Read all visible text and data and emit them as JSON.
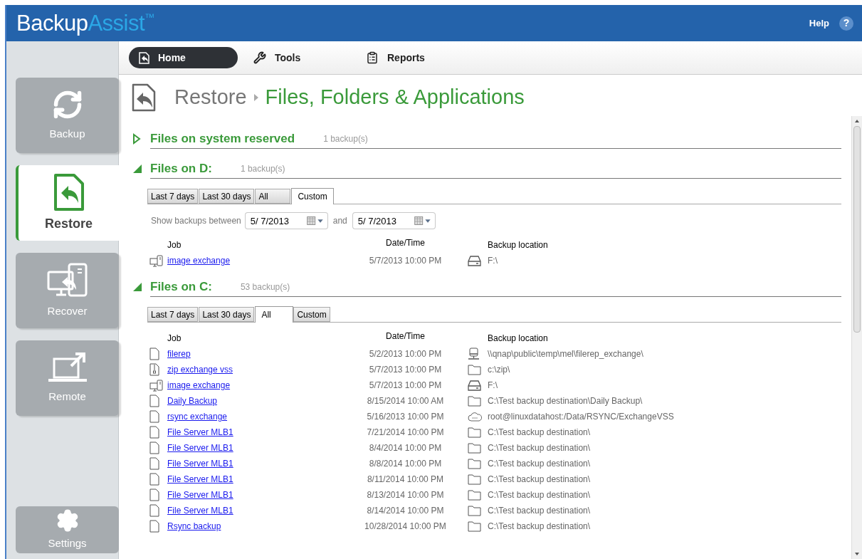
{
  "app": {
    "brand": "Backup",
    "brand_accent": "Assist",
    "trademark": "™",
    "help": "Help",
    "help_icon": "?"
  },
  "sidebar": {
    "items": [
      {
        "label": "Backup",
        "kind": "backup",
        "selected": false
      },
      {
        "label": "Restore",
        "kind": "restore",
        "selected": true
      },
      {
        "label": "Recover",
        "kind": "recover",
        "selected": false
      },
      {
        "label": "Remote",
        "kind": "remote",
        "selected": false
      },
      {
        "label": "Settings",
        "kind": "settings",
        "selected": false
      }
    ]
  },
  "toolbar": {
    "items": [
      {
        "label": "Home",
        "kind": "home",
        "selected": true
      },
      {
        "label": "Tools",
        "kind": "tools",
        "selected": false
      },
      {
        "label": "Reports",
        "kind": "reports",
        "selected": false
      }
    ]
  },
  "breadcrumb": {
    "parent": "Restore",
    "current": "Files, Folders & Applications"
  },
  "sections": [
    {
      "title": "Files on system reserved",
      "count": "1 backup(s)",
      "expanded": false
    },
    {
      "title": "Files on D:",
      "count": "1 backup(s)",
      "expanded": true,
      "tabs": [
        {
          "label": "Last 7 days",
          "selected": false
        },
        {
          "label": "Last 30 days",
          "selected": false
        },
        {
          "label": "All",
          "selected": false
        },
        {
          "label": "Custom",
          "selected": true
        }
      ],
      "filter": {
        "label": "Show backups between",
        "from": "5/ 7/2013",
        "joiner": "and",
        "to": "5/ 7/2013"
      },
      "columns": [
        "Job",
        "Date/Time",
        "Backup location"
      ],
      "rows": [
        {
          "job": {
            "kind": "image",
            "label": "image exchange"
          },
          "date": "5/7/2013 10:00 PM",
          "location": {
            "kind": "drive",
            "path": "F:\\"
          }
        }
      ]
    },
    {
      "title": "Files on C:",
      "count": "53 backup(s)",
      "expanded": true,
      "tabs": [
        {
          "label": "Last 7 days",
          "selected": false
        },
        {
          "label": "Last 30 days",
          "selected": false
        },
        {
          "label": "All",
          "selected": true
        },
        {
          "label": "Custom",
          "selected": false
        }
      ],
      "columns": [
        "Job",
        "Date/Time",
        "Backup location"
      ],
      "rows": [
        {
          "job": {
            "kind": "file",
            "label": "filerep"
          },
          "date": "5/2/2013 10:00 PM",
          "location": {
            "kind": "network",
            "path": "\\\\qnap\\public\\temp\\mel\\filerep_exchange\\"
          }
        },
        {
          "job": {
            "kind": "zip",
            "label": "zip exchange vss"
          },
          "date": "5/7/2013 10:00 PM",
          "location": {
            "kind": "folder",
            "path": "c:\\zip\\"
          }
        },
        {
          "job": {
            "kind": "image",
            "label": "image exchange"
          },
          "date": "5/7/2013 10:00 PM",
          "location": {
            "kind": "drive",
            "path": "F:\\"
          }
        },
        {
          "job": {
            "kind": "file",
            "label": "Daily Backup"
          },
          "date": "8/15/2014 10:00 AM",
          "location": {
            "kind": "folder",
            "path": "C:\\Test backup destination\\Daily Backup\\"
          }
        },
        {
          "job": {
            "kind": "file",
            "label": "rsync exchange"
          },
          "date": "5/16/2013 10:00 PM",
          "location": {
            "kind": "cloud",
            "path": "root@linuxdatahost:/Data/RSYNC/ExchangeVSS"
          }
        },
        {
          "job": {
            "kind": "file",
            "label": "File Server MLB1"
          },
          "date": "7/21/2014 10:00 PM",
          "location": {
            "kind": "folder",
            "path": "C:\\Test backup destination\\"
          }
        },
        {
          "job": {
            "kind": "file",
            "label": "File Server MLB1"
          },
          "date": "8/4/2014 10:00 PM",
          "location": {
            "kind": "folder",
            "path": "C:\\Test backup destination\\"
          }
        },
        {
          "job": {
            "kind": "file",
            "label": "File Server MLB1"
          },
          "date": "8/8/2014 10:00 PM",
          "location": {
            "kind": "folder",
            "path": "C:\\Test backup destination\\"
          }
        },
        {
          "job": {
            "kind": "file",
            "label": "File Server MLB1"
          },
          "date": "8/11/2014 10:00 PM",
          "location": {
            "kind": "folder",
            "path": "C:\\Test backup destination\\"
          }
        },
        {
          "job": {
            "kind": "file",
            "label": "File Server MLB1"
          },
          "date": "8/13/2014 10:00 PM",
          "location": {
            "kind": "folder",
            "path": "C:\\Test backup destination\\"
          }
        },
        {
          "job": {
            "kind": "file",
            "label": "File Server MLB1"
          },
          "date": "8/14/2014 10:00 PM",
          "location": {
            "kind": "folder",
            "path": "C:\\Test backup destination\\"
          }
        },
        {
          "job": {
            "kind": "file",
            "label": "Rsync backup"
          },
          "date": "10/28/2014 10:00 PM",
          "location": {
            "kind": "folder",
            "path": "C:\\Test backup destination\\"
          }
        }
      ]
    }
  ]
}
